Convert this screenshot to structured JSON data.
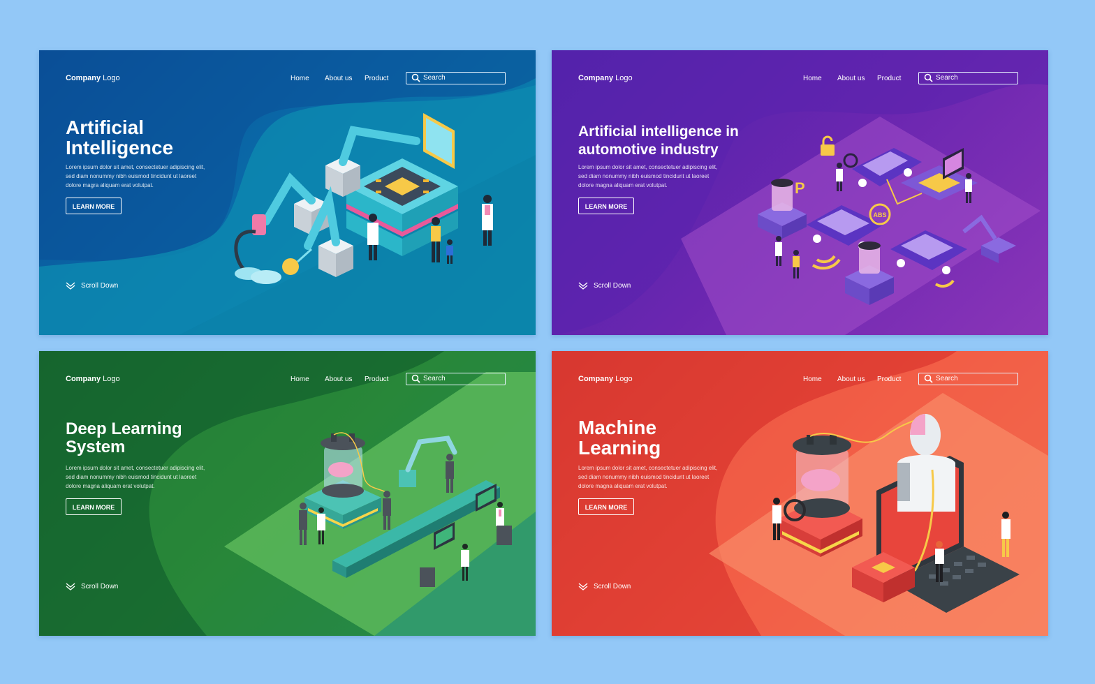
{
  "background_color": "#93c8f7",
  "panels": [
    {
      "id": "ai",
      "accent": "#0b6aa8",
      "logo_bold": "Company",
      "logo_rest": " Logo",
      "nav": [
        "Home",
        "About us",
        "Product"
      ],
      "search_placeholder": "Search",
      "title_lines": [
        "Artificial",
        "Intelligence"
      ],
      "body": [
        "Lorem ipsum dolor sit amet, consectetuer adipiscing elit,",
        "sed diam nonummy nibh euismod tincidunt ut laoreet",
        "dolore magra aliquam erat volutpat."
      ],
      "button": "LEARN MORE",
      "scroll": "Scroll Down",
      "illustration": "robot-arms-chip-factory"
    },
    {
      "id": "automotive",
      "accent": "#6a26b0",
      "logo_bold": "Company",
      "logo_rest": " Logo",
      "nav": [
        "Home",
        "About us",
        "Product"
      ],
      "search_placeholder": "Search",
      "title_lines": [
        "Artificial intelligence in",
        "automotive industry"
      ],
      "body": [
        "Lorem ipsum dolor sit amet, consectetuer adipiscing elit,",
        "sed diam nonummy nibh euismod tincidunt ut laoreet",
        "dolore magna aliquam erat volutpat."
      ],
      "button": "LEARN MORE",
      "scroll": "Scroll Down",
      "illustration_labels": {
        "abs": "ABS",
        "parking": "P"
      }
    },
    {
      "id": "deep-learning",
      "accent": "#1e7a35",
      "logo_bold": "Company",
      "logo_rest": " Logo",
      "nav": [
        "Home",
        "About us",
        "Product"
      ],
      "search_placeholder": "Search",
      "title_lines": [
        "Deep Learning",
        "System"
      ],
      "body": [
        "Lorem ipsum dolor sit amet, consectetuer adipiscing elit,",
        "sed diam nonummy nibh euismod tincidunt ut laoreet",
        "dolore magna aliquam erat volutpat."
      ],
      "button": "LEARN MORE",
      "scroll": "Scroll Down",
      "illustration": "brain-jar-conveyor"
    },
    {
      "id": "machine-learning",
      "accent": "#ef4a3a",
      "logo_bold": "Company",
      "logo_rest": " Logo",
      "nav": [
        "Home",
        "About us",
        "Product"
      ],
      "search_placeholder": "Search",
      "title_lines": [
        "Machine",
        "Learning"
      ],
      "body": [
        "Lorem ipsum dolor sit amet, consectetuer adipiscing elit,",
        "sed diam nonummy nibh euismod tincidunt ut laoreet",
        "dolore magna aliquam erat volutpat."
      ],
      "button": "LEARN MORE",
      "scroll": "Scroll Down",
      "illustration": "robot-laptop-brain-jar"
    }
  ]
}
